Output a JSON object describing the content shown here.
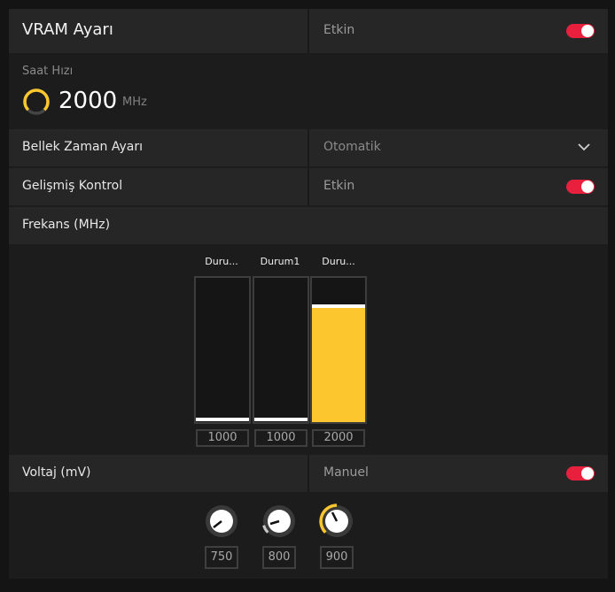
{
  "header": {
    "title": "VRAM Ayarı",
    "state": "Etkin",
    "toggle_on": true
  },
  "clock": {
    "label": "Saat Hızı",
    "value": "2000",
    "unit": "MHz"
  },
  "memory_timing": {
    "label": "Bellek Zaman Ayarı",
    "value": "Otomatik"
  },
  "advanced": {
    "label": "Gelişmiş Kontrol",
    "state": "Etkin",
    "toggle_on": true
  },
  "frequency": {
    "label": "Frekans (MHz)",
    "states": [
      {
        "name": "Duru...",
        "value": "1000",
        "level": 0.0
      },
      {
        "name": "Durum1",
        "value": "1000",
        "level": 0.0
      },
      {
        "name": "Duru...",
        "value": "2000",
        "level": 0.79
      }
    ]
  },
  "voltage": {
    "label": "Voltaj (mV)",
    "mode": "Manuel",
    "toggle_on": true,
    "knobs": [
      {
        "value": "750"
      },
      {
        "value": "800"
      },
      {
        "value": "900"
      }
    ]
  },
  "colors": {
    "accent": "#fcc72e",
    "toggle": "#e8203e"
  }
}
